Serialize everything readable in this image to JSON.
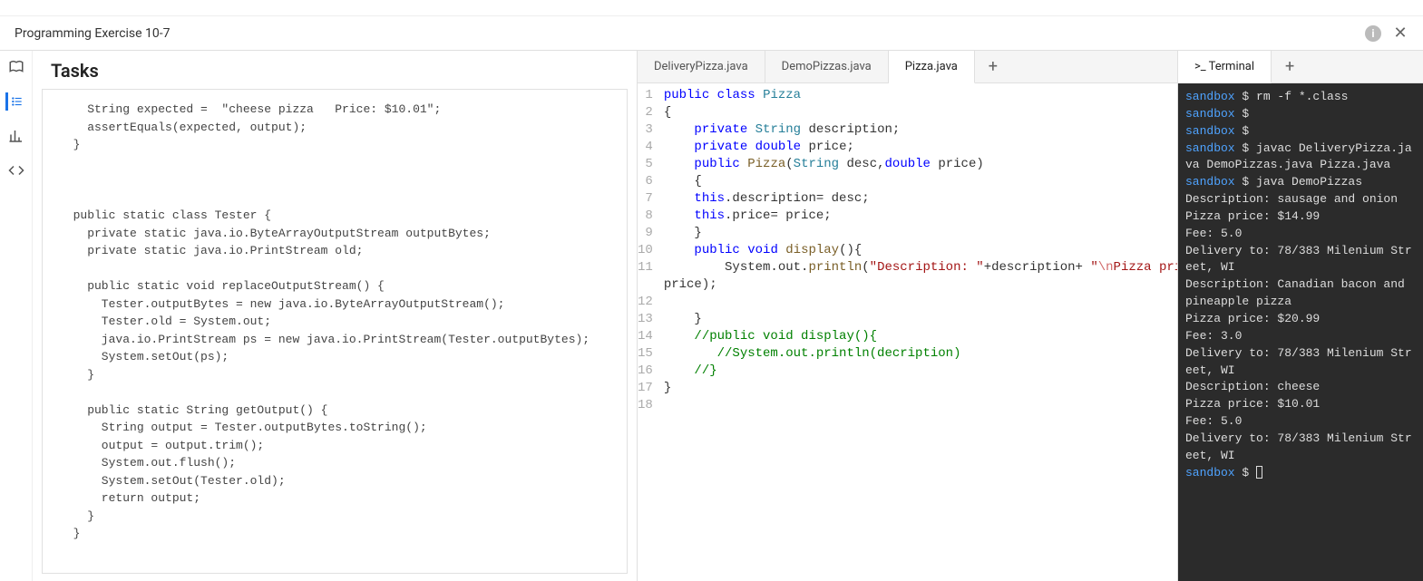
{
  "breadcrumb": {
    "title": "Programming Exercise 10-7"
  },
  "sidebar": {
    "items": [
      {
        "name": "book-icon"
      },
      {
        "name": "list-icon"
      },
      {
        "name": "chart-icon"
      },
      {
        "name": "code-icon"
      }
    ]
  },
  "tasks": {
    "heading": "Tasks",
    "code": "    String expected =  \"cheese pizza   Price: $10.01\";\n    assertEquals(expected, output);\n  }\n\n\n\n  public static class Tester {\n    private static java.io.ByteArrayOutputStream outputBytes;\n    private static java.io.PrintStream old;\n\n    public static void replaceOutputStream() {\n      Tester.outputBytes = new java.io.ByteArrayOutputStream();\n      Tester.old = System.out;\n      java.io.PrintStream ps = new java.io.PrintStream(Tester.outputBytes);\n      System.setOut(ps);\n    }\n\n    public static String getOutput() {\n      String output = Tester.outputBytes.toString();\n      output = output.trim();\n      System.out.flush();\n      System.setOut(Tester.old);\n      return output;\n    }\n  }"
  },
  "editor": {
    "tabs": [
      {
        "label": "DeliveryPizza.java",
        "active": false
      },
      {
        "label": "DemoPizzas.java",
        "active": false
      },
      {
        "label": "Pizza.java",
        "active": true
      }
    ],
    "add_label": "+",
    "code_lines": [
      {
        "n": 1,
        "tokens": [
          [
            "kw",
            "public"
          ],
          [
            "",
            " "
          ],
          [
            "kw",
            "class"
          ],
          [
            "",
            " "
          ],
          [
            "type",
            "Pizza"
          ]
        ]
      },
      {
        "n": 2,
        "tokens": [
          [
            "",
            "{"
          ]
        ]
      },
      {
        "n": 3,
        "tokens": [
          [
            "",
            "    "
          ],
          [
            "kw",
            "private"
          ],
          [
            "",
            " "
          ],
          [
            "type",
            "String"
          ],
          [
            "",
            " description;"
          ]
        ]
      },
      {
        "n": 4,
        "tokens": [
          [
            "",
            "    "
          ],
          [
            "kw",
            "private"
          ],
          [
            "",
            " "
          ],
          [
            "kw",
            "double"
          ],
          [
            "",
            " price;"
          ]
        ]
      },
      {
        "n": 5,
        "tokens": [
          [
            "",
            "    "
          ],
          [
            "kw",
            "public"
          ],
          [
            "",
            " "
          ],
          [
            "method",
            "Pizza"
          ],
          [
            "",
            "("
          ],
          [
            "type",
            "String"
          ],
          [
            "",
            " desc,"
          ],
          [
            "kw",
            "double"
          ],
          [
            "",
            " price)"
          ]
        ]
      },
      {
        "n": 6,
        "tokens": [
          [
            "",
            "    {"
          ]
        ]
      },
      {
        "n": 7,
        "tokens": [
          [
            "",
            "    "
          ],
          [
            "kw",
            "this"
          ],
          [
            "",
            ".description= desc;"
          ]
        ]
      },
      {
        "n": 8,
        "tokens": [
          [
            "",
            "    "
          ],
          [
            "kw",
            "this"
          ],
          [
            "",
            ".price= price;"
          ]
        ]
      },
      {
        "n": 9,
        "tokens": [
          [
            "",
            "    }"
          ]
        ]
      },
      {
        "n": 10,
        "tokens": [
          [
            "",
            "    "
          ],
          [
            "kw",
            "public"
          ],
          [
            "",
            " "
          ],
          [
            "kw",
            "void"
          ],
          [
            "",
            " "
          ],
          [
            "method",
            "display"
          ],
          [
            "",
            "(){"
          ]
        ]
      },
      {
        "n": 11,
        "tokens": [
          [
            "",
            "        System.out."
          ],
          [
            "method",
            "println"
          ],
          [
            "",
            "("
          ],
          [
            "str",
            "\"Description: \""
          ],
          [
            "",
            "+description+ "
          ],
          [
            "str",
            "\""
          ],
          [
            "esc",
            "\\n"
          ],
          [
            "str",
            "Pizza pri"
          ]
        ]
      },
      {
        "n": "",
        "tokens": [
          [
            "",
            "price);"
          ]
        ]
      },
      {
        "n": 12,
        "tokens": [
          [
            "",
            ""
          ]
        ]
      },
      {
        "n": 13,
        "tokens": [
          [
            "",
            "    }"
          ]
        ]
      },
      {
        "n": 14,
        "tokens": [
          [
            "",
            "    "
          ],
          [
            "comment",
            "//public void display(){"
          ]
        ]
      },
      {
        "n": 15,
        "tokens": [
          [
            "",
            "       "
          ],
          [
            "comment",
            "//System.out.println(decription)"
          ]
        ]
      },
      {
        "n": 16,
        "tokens": [
          [
            "",
            "    "
          ],
          [
            "comment",
            "//}"
          ]
        ]
      },
      {
        "n": 17,
        "tokens": [
          [
            "",
            "}"
          ]
        ]
      },
      {
        "n": 18,
        "tokens": [
          [
            "",
            ""
          ]
        ]
      }
    ]
  },
  "terminal": {
    "tab_label": ">_ Terminal",
    "add_label": "+",
    "lines": [
      {
        "prompt": "sandbox",
        "sep": " $ ",
        "cmd": "rm -f *.class"
      },
      {
        "prompt": "sandbox",
        "sep": " $ ",
        "cmd": ""
      },
      {
        "prompt": "sandbox",
        "sep": " $ ",
        "cmd": ""
      },
      {
        "prompt": "sandbox",
        "sep": " $ ",
        "cmd": "javac DeliveryPizza.java DemoPizzas.java Pizza.java"
      },
      {
        "prompt": "sandbox",
        "sep": " $ ",
        "cmd": "java DemoPizzas"
      },
      {
        "out": "Description: sausage and onion"
      },
      {
        "out": "Pizza price: $14.99"
      },
      {
        "out": "Fee: 5.0"
      },
      {
        "out": "Delivery to: 78/383 Milenium Street, WI"
      },
      {
        "out": "Description: Canadian bacon and pineapple pizza"
      },
      {
        "out": "Pizza price: $20.99"
      },
      {
        "out": "Fee: 3.0"
      },
      {
        "out": "Delivery to: 78/383 Milenium Street, WI"
      },
      {
        "out": "Description: cheese"
      },
      {
        "out": "Pizza price: $10.01"
      },
      {
        "out": "Fee: 5.0"
      },
      {
        "out": "Delivery to: 78/383 Milenium Street, WI"
      },
      {
        "prompt": "sandbox",
        "sep": " $ ",
        "cursor": true
      }
    ]
  }
}
